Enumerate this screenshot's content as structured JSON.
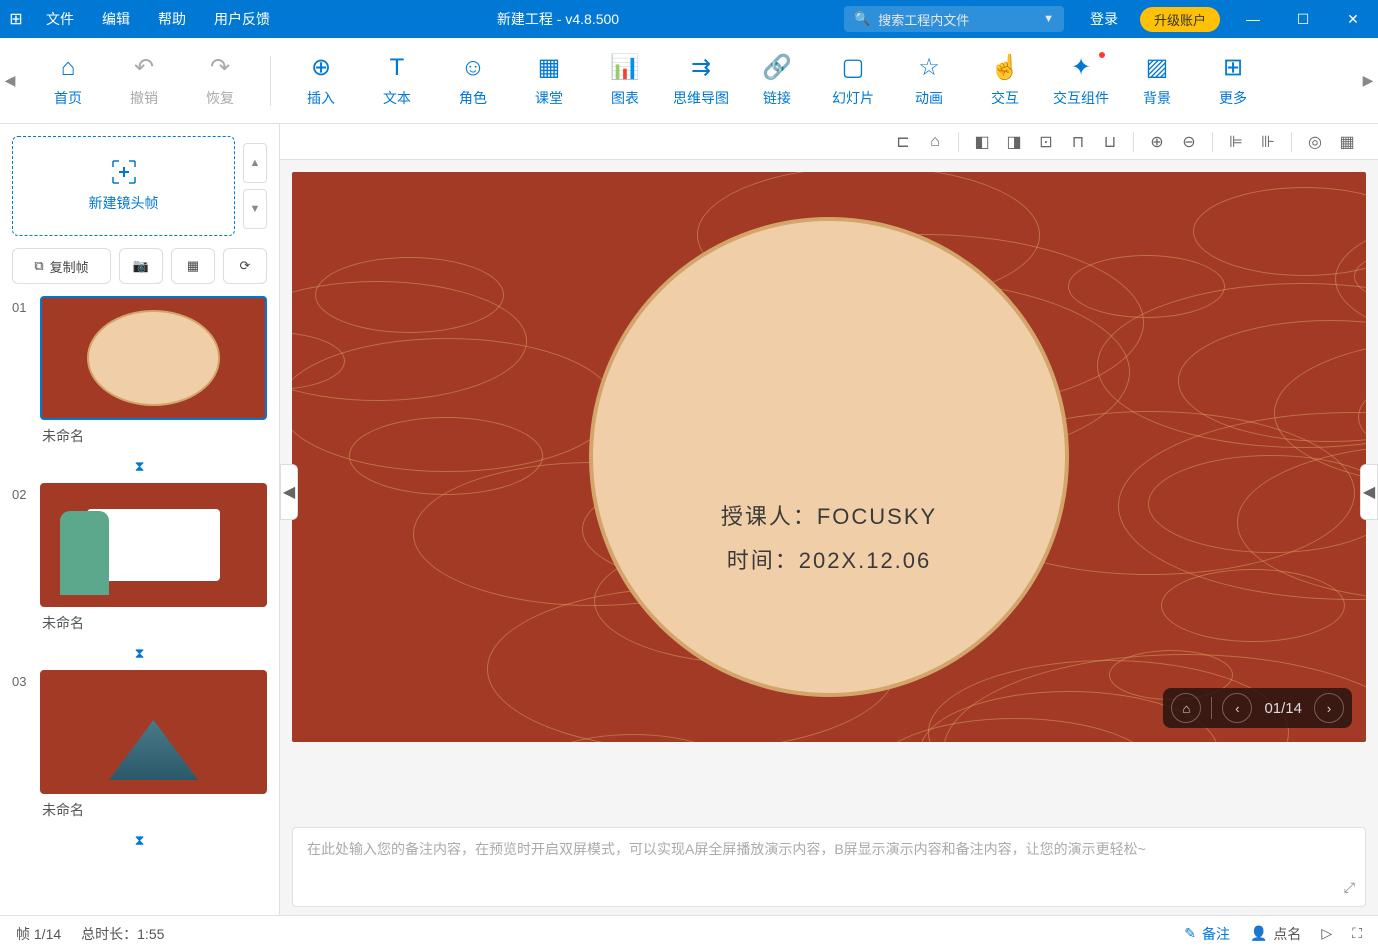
{
  "titlebar": {
    "menus": [
      "文件",
      "编辑",
      "帮助",
      "用户反馈"
    ],
    "doc_title": "新建工程 - v4.8.500",
    "search_placeholder": "搜索工程内文件",
    "login": "登录",
    "upgrade": "升级账户"
  },
  "toolbar": {
    "items": [
      {
        "label": "首页",
        "icon": "⌂"
      },
      {
        "label": "撤销",
        "icon": "↶",
        "gray": true
      },
      {
        "label": "恢复",
        "icon": "↷",
        "gray": true
      },
      {
        "label": "插入",
        "icon": "⊕",
        "divider_before": true
      },
      {
        "label": "文本",
        "icon": "T"
      },
      {
        "label": "角色",
        "icon": "☺"
      },
      {
        "label": "课堂",
        "icon": "▦"
      },
      {
        "label": "图表",
        "icon": "📊"
      },
      {
        "label": "思维导图",
        "icon": "⇉"
      },
      {
        "label": "链接",
        "icon": "🔗"
      },
      {
        "label": "幻灯片",
        "icon": "▢"
      },
      {
        "label": "动画",
        "icon": "☆"
      },
      {
        "label": "交互",
        "icon": "☝"
      },
      {
        "label": "交互组件",
        "icon": "✦",
        "red_dot": true
      },
      {
        "label": "背景",
        "icon": "▨"
      },
      {
        "label": "更多",
        "icon": "⊞"
      }
    ]
  },
  "left_panel": {
    "new_frame": "新建镜头帧",
    "copy_frame": "复制帧",
    "slides": [
      {
        "num": "01",
        "label": "未命名",
        "selected": true,
        "thumb": "t1"
      },
      {
        "num": "02",
        "label": "未命名",
        "thumb": "t2"
      },
      {
        "num": "03",
        "label": "未命名",
        "thumb": "t3"
      }
    ]
  },
  "canvas": {
    "text1": "授课人：FOCUSKY",
    "text2": "时间：202X.12.06",
    "nav_counter": "01/14"
  },
  "notes": {
    "placeholder": "在此处输入您的备注内容，在预览时开启双屏模式，可以实现A屏全屏播放演示内容，B屏显示演示内容和备注内容，让您的演示更轻松~"
  },
  "statusbar": {
    "frame": "帧 1/14",
    "duration": "总时长：1:55",
    "notes": "备注",
    "roll_call": "点名"
  }
}
